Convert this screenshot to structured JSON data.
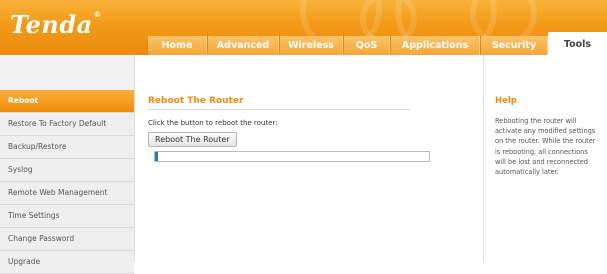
{
  "brand": {
    "name": "Tenda",
    "mark": "®"
  },
  "tabs": [
    {
      "label": "Home",
      "active": false
    },
    {
      "label": "Advanced",
      "active": false
    },
    {
      "label": "Wireless",
      "active": false
    },
    {
      "label": "QoS",
      "active": false
    },
    {
      "label": "Applications",
      "active": false
    },
    {
      "label": "Security",
      "active": false
    },
    {
      "label": "Tools",
      "active": true
    }
  ],
  "sidebar": {
    "items": [
      {
        "label": "Reboot",
        "active": true
      },
      {
        "label": "Restore To Factory Default",
        "active": false
      },
      {
        "label": "Backup/Restore",
        "active": false
      },
      {
        "label": "Syslog",
        "active": false
      },
      {
        "label": "Remote Web Management",
        "active": false
      },
      {
        "label": "Time Settings",
        "active": false
      },
      {
        "label": "Change Password",
        "active": false
      },
      {
        "label": "Upgrade",
        "active": false
      }
    ]
  },
  "main": {
    "title": "Reboot The Router",
    "description": "Click the button to reboot the router:",
    "button_label": "Reboot The Router",
    "progress_fraction": 0.01
  },
  "help": {
    "title": "Help",
    "text": "Rebooting the router will activate any modified settings on the router. While the router is rebooting, all connections will be lost and reconnected automatically later."
  },
  "colors": {
    "accent": "#f39a17",
    "title_orange": "#f08c12",
    "progress_blue": "#1e7fb8"
  }
}
